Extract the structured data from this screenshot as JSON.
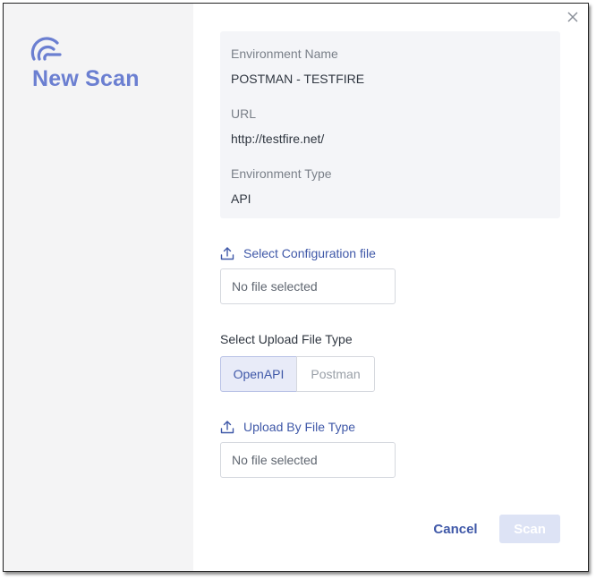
{
  "dialog": {
    "title": "New Scan",
    "close_icon": "close-icon"
  },
  "environment": {
    "name_label": "Environment Name",
    "name_value": "POSTMAN - TESTFIRE",
    "url_label": "URL",
    "url_value": "http://testfire.net/",
    "type_label": "Environment Type",
    "type_value": "API"
  },
  "config_file": {
    "link_label": "Select Configuration file",
    "icon": "upload-icon",
    "file_status": "No file selected"
  },
  "upload_type": {
    "label": "Select Upload File Type",
    "options": [
      "OpenAPI",
      "Postman"
    ],
    "selected": "OpenAPI"
  },
  "file_type_upload": {
    "link_label": "Upload By File Type",
    "icon": "upload-icon",
    "file_status": "No file selected"
  },
  "actions": {
    "cancel_label": "Cancel",
    "scan_label": "Scan",
    "scan_enabled": false
  },
  "colors": {
    "accent": "#3f58a8",
    "brand": "#6b7fd1",
    "sidebar_bg": "#f4f4f5",
    "panel_bg": "#f4f5f8",
    "selected_bg": "#e8ebf8",
    "disabled_btn": "#dde3f5"
  }
}
